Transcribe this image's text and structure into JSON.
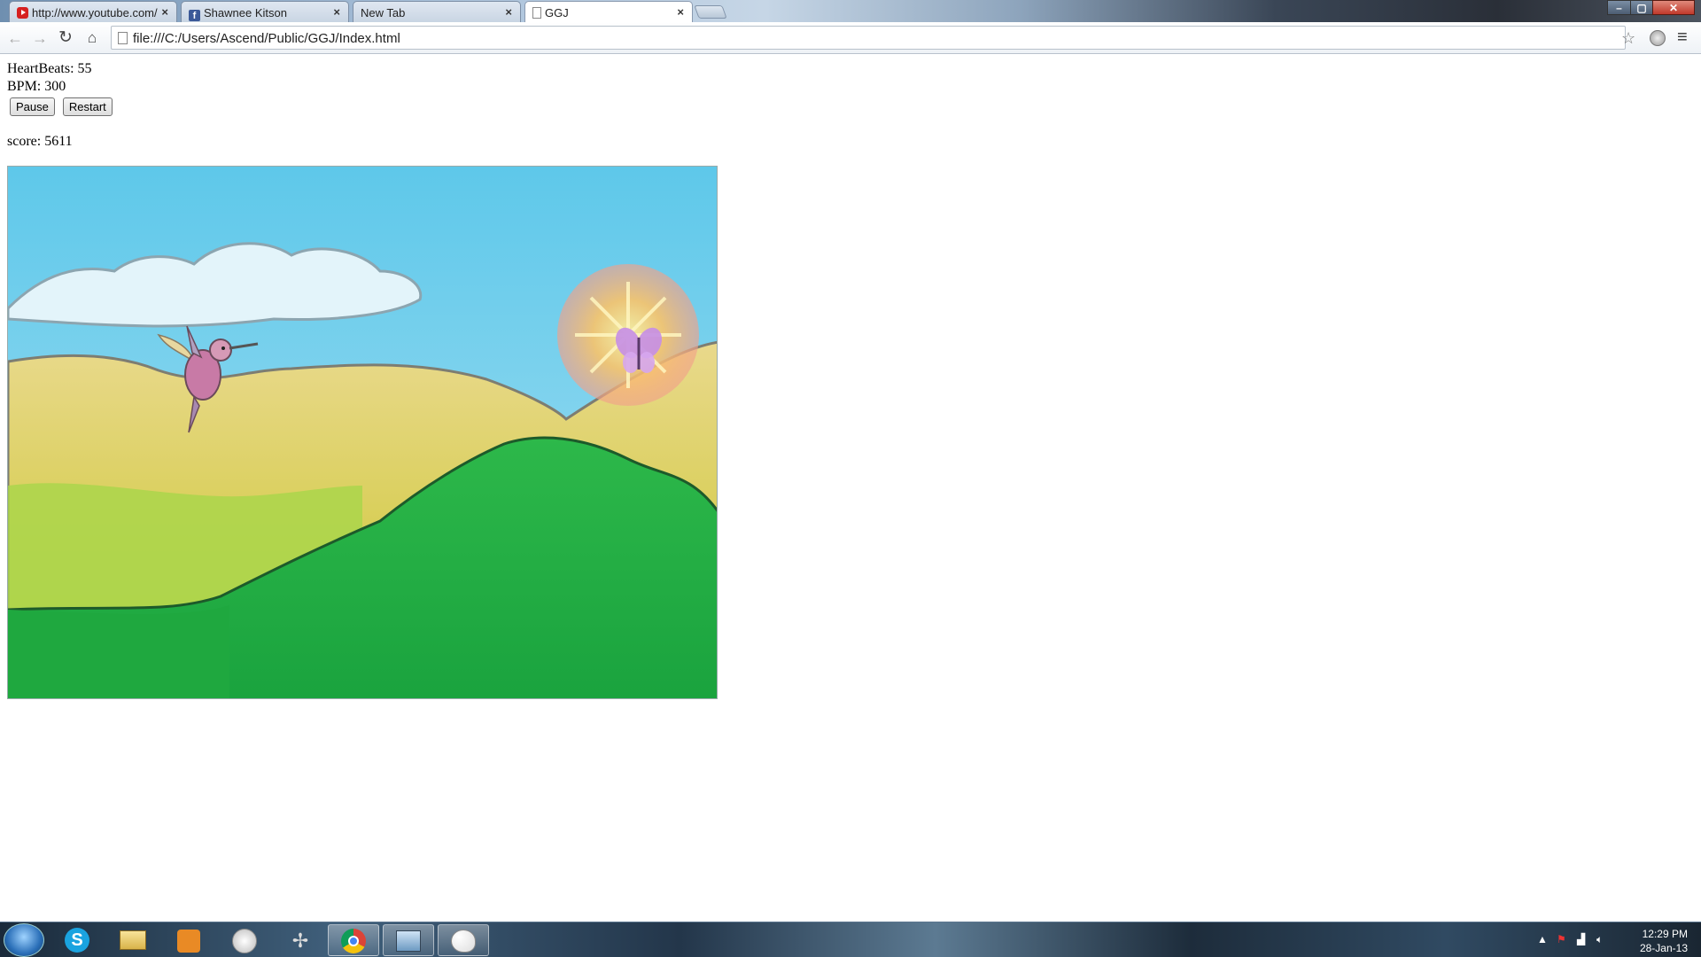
{
  "browser": {
    "tabs": [
      {
        "label": "http://www.youtube.com/",
        "icon": "youtube-icon"
      },
      {
        "label": "Shawnee Kitson",
        "icon": "facebook-icon"
      },
      {
        "label": "New Tab",
        "icon": ""
      },
      {
        "label": "GGJ",
        "icon": "page-icon",
        "active": true
      }
    ],
    "window_controls": {
      "minimize": "–",
      "maximize": "▢",
      "close": "✕"
    },
    "address": "file:///C:/Users/Ascend/Public/GGJ/Index.html"
  },
  "page": {
    "heartbeats": "HeartBeats: 55",
    "bpm": "BPM: 300",
    "pause_label": "Pause",
    "restart_label": "Restart",
    "score": "score: 5611"
  },
  "game_scene": {
    "elements": [
      "sky",
      "cloud",
      "hills",
      "green-hill",
      "hummingbird",
      "sun-flower",
      "butterfly"
    ]
  },
  "taskbar": {
    "apps": [
      "skype",
      "explorer",
      "media-player",
      "app-4",
      "app-5",
      "chrome",
      "control-panel",
      "paint"
    ],
    "time": "12:29 PM",
    "date": "28-Jan-13"
  }
}
